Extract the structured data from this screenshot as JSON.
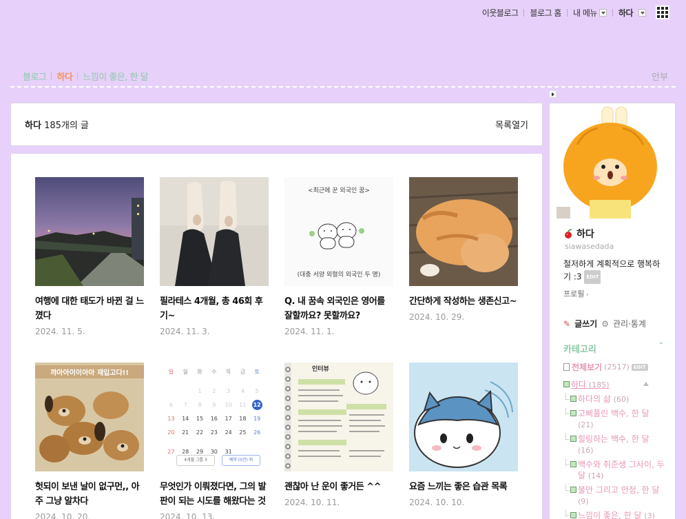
{
  "gnb": {
    "neighbor_blog": "이웃블로그",
    "blog_home": "블로그 홈",
    "my_menu": "내 메뉴",
    "user": "하다"
  },
  "blog_menu": {
    "items": [
      "블로그",
      "하다",
      "느낌이 좋은, 한 달"
    ],
    "right": "안부"
  },
  "list_head": {
    "name": "하다",
    "count": "185개의 글",
    "open_list": "목록열기"
  },
  "posts": [
    {
      "title": "여행에 대한 태도가 바뀐 걸 느꼈다",
      "date": "2024. 11. 5.",
      "thumb": "evening-river-photo"
    },
    {
      "title": "필라테스 4개월, 총 46회 후기~",
      "date": "2024. 11. 3.",
      "thumb": "toe-socks-photo"
    },
    {
      "title": "Q. 내 꿈속 외국인은 영어를 잘할까요? 못할까요?",
      "date": "2024. 11. 1.",
      "thumb": "doodle-illustration"
    },
    {
      "title": "간단하게 작성하는 생존신고~",
      "date": "2024. 10. 29.",
      "thumb": "orange-cat-photo"
    },
    {
      "title": "헛되이 보낸 날이 없구먼,, 아주 그냥 알차다",
      "date": "2024. 10. 20.",
      "thumb": "plush-dogs-photo"
    },
    {
      "title": "무엇인가 이뤄졌다면, 그의 발판이 되는 시도를 해왔다는 것",
      "date": "2024. 10. 13.",
      "thumb": "calendar-screenshot"
    },
    {
      "title": "괜찮아 난 운이 좋거든 ^^",
      "date": "2024. 10. 11.",
      "thumb": "journal-page-photo"
    },
    {
      "title": "요즘 느끼는 좋은 습관 목록",
      "date": "2024. 10. 10.",
      "thumb": "cat-character-illustration"
    }
  ],
  "thumb_text": {
    "doodle_caption_top": "<최근에 꾼 외국인 꿈>",
    "doodle_caption_bottom": "(대충 서양 외형의 외국인 두 명)",
    "plush_banner": "꺄아아이이아아 재입고다!!",
    "calendar_days": [
      "일",
      "월",
      "화",
      "수",
      "목",
      "금",
      "토"
    ],
    "calendar_rows": [
      [
        "",
        "",
        "1",
        "2",
        "3",
        "4",
        "5"
      ],
      [
        "6",
        "7",
        "8",
        "9",
        "10",
        "11",
        "12"
      ],
      [
        "13",
        "14",
        "15",
        "16",
        "17",
        "18",
        "19"
      ],
      [
        "20",
        "21",
        "22",
        "23",
        "24",
        "25",
        "26"
      ],
      [
        "27",
        "28",
        "29",
        "30",
        "31",
        "",
        ""
      ]
    ],
    "calendar_today": "12",
    "calendar_footer_left": "4개월 그룹 3",
    "calendar_footer_right": "예약 (0건) 외",
    "journal_title": "인터뷰"
  },
  "sidebar": {
    "nickname": "하다",
    "user_id": "siawasedada",
    "intro": "철저하게 계획적으로 행복하기 :3",
    "edit": "EDIT",
    "profile_link": "프로필",
    "write": "글쓰기",
    "manage": "관리·통계",
    "category_title": "카테고리",
    "all_posts": "전체보기",
    "all_count": "(2517)",
    "categories": [
      {
        "name": "하다",
        "count": "(185)",
        "level": 0
      },
      {
        "name": "하다의 삶",
        "count": "(60)",
        "level": 1
      },
      {
        "name": "고삐풀린 백수, 한 달",
        "count": "(21)",
        "level": 1
      },
      {
        "name": "힐링하는 백수, 한 달",
        "count": "(16)",
        "level": 1
      },
      {
        "name": "백수와 취준생 그사이, 두 달",
        "count": "(14)",
        "level": 1
      },
      {
        "name": "불안 그리고 안정, 한 달",
        "count": "(9)",
        "level": 1
      },
      {
        "name": "느낌이 좋은, 한 달",
        "count": "(3)",
        "level": 1
      }
    ]
  },
  "colors": {
    "background": "#e7d1fa",
    "accent_orange": "#f2925d",
    "accent_green": "#8bc8a6",
    "category_pink": "#e995b5"
  }
}
